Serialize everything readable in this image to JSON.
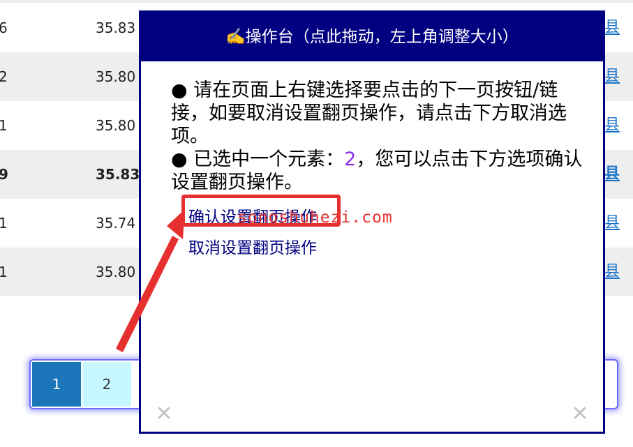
{
  "table": {
    "rows": [
      {
        "col_a": "6",
        "col_b": "35.83",
        "col_c": "县",
        "bold": false
      },
      {
        "col_a": "2",
        "col_b": "35.80",
        "col_c": "县",
        "bold": false
      },
      {
        "col_a": "1",
        "col_b": "35.80",
        "col_c": "县",
        "bold": false
      },
      {
        "col_a": "9",
        "col_b": "35.83",
        "col_c": "县",
        "bold": true
      },
      {
        "col_a": "1",
        "col_b": "35.74",
        "col_c": "县",
        "bold": false
      },
      {
        "col_a": "1",
        "col_b": "35.80",
        "col_c": "县",
        "bold": false
      }
    ]
  },
  "pager": {
    "current": "1",
    "next": "2"
  },
  "console": {
    "title": "✍️操作台（点此拖动，左上角调整大小）",
    "instruction": "● 请在页面上右键选择要点击的下一页按钮/链接，如要取消设置翻页操作，请点击下方取消选项。",
    "selected_prefix": "● 已选中一个元素：",
    "selected_value": "2",
    "selected_suffix": "，您可以点击下方选项确认设置翻页操作。",
    "confirm_link": "确认设置翻页操作",
    "cancel_link": "取消设置翻页操作",
    "close_symbol": "✕"
  },
  "watermark": "songshuhezi.com",
  "colors": {
    "header_bg": "#000080",
    "active_page": "#1a76b8",
    "next_page": "#c8f8ff",
    "annotation": "#e63030",
    "link": "#000080"
  }
}
